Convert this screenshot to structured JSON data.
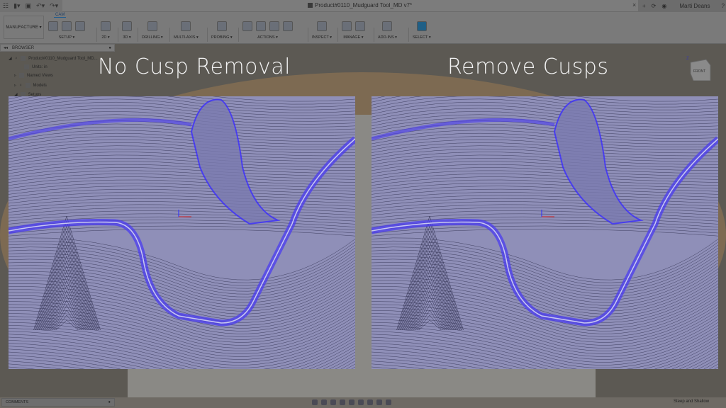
{
  "title_bar": {
    "document_title": "Product#0110_Mudguard Tool_MD v7*",
    "user_name": "Marti Deans",
    "close_tab": "×"
  },
  "toolbar": {
    "workspace": "MANUFACTURE ▾",
    "active_tab": "CAM",
    "groups": [
      {
        "label": "SETUP ▾",
        "icons": 3
      },
      {
        "label": "2D ▾",
        "icons": 1
      },
      {
        "label": "3D ▾",
        "icons": 1
      },
      {
        "label": "DRILLING ▾",
        "icons": 1
      },
      {
        "label": "MULTI-AXIS ▾",
        "icons": 1
      },
      {
        "label": "PROBING ▾",
        "icons": 1
      },
      {
        "label": "ACTIONS ▾",
        "icons": 4
      },
      {
        "label": "INSPECT ▾",
        "icons": 1
      },
      {
        "label": "MANAGE ▾",
        "icons": 2
      },
      {
        "label": "ADD-INS ▾",
        "icons": 1
      },
      {
        "label": "SELECT ▾",
        "icons": 1
      }
    ]
  },
  "browser": {
    "header": "BROWSER",
    "items": [
      {
        "label": "Product#0110_Mudguard Tool_MD..."
      },
      {
        "label": "Units: in"
      },
      {
        "label": "Named Views"
      },
      {
        "label": "Models"
      },
      {
        "label": "Setups"
      }
    ]
  },
  "comparison": {
    "left_caption": "No Cusp Removal",
    "right_caption": "Remove Cusps"
  },
  "viewcube": {
    "face": "FRONT",
    "axis_z": "Z"
  },
  "bottom": {
    "comments": "COMMENTS",
    "status": "Steep and Shallow"
  },
  "colors": {
    "toolpath_blue": "#3a2cff",
    "panel_bg": "#8f8fb8",
    "accent": "#1e5c90"
  }
}
